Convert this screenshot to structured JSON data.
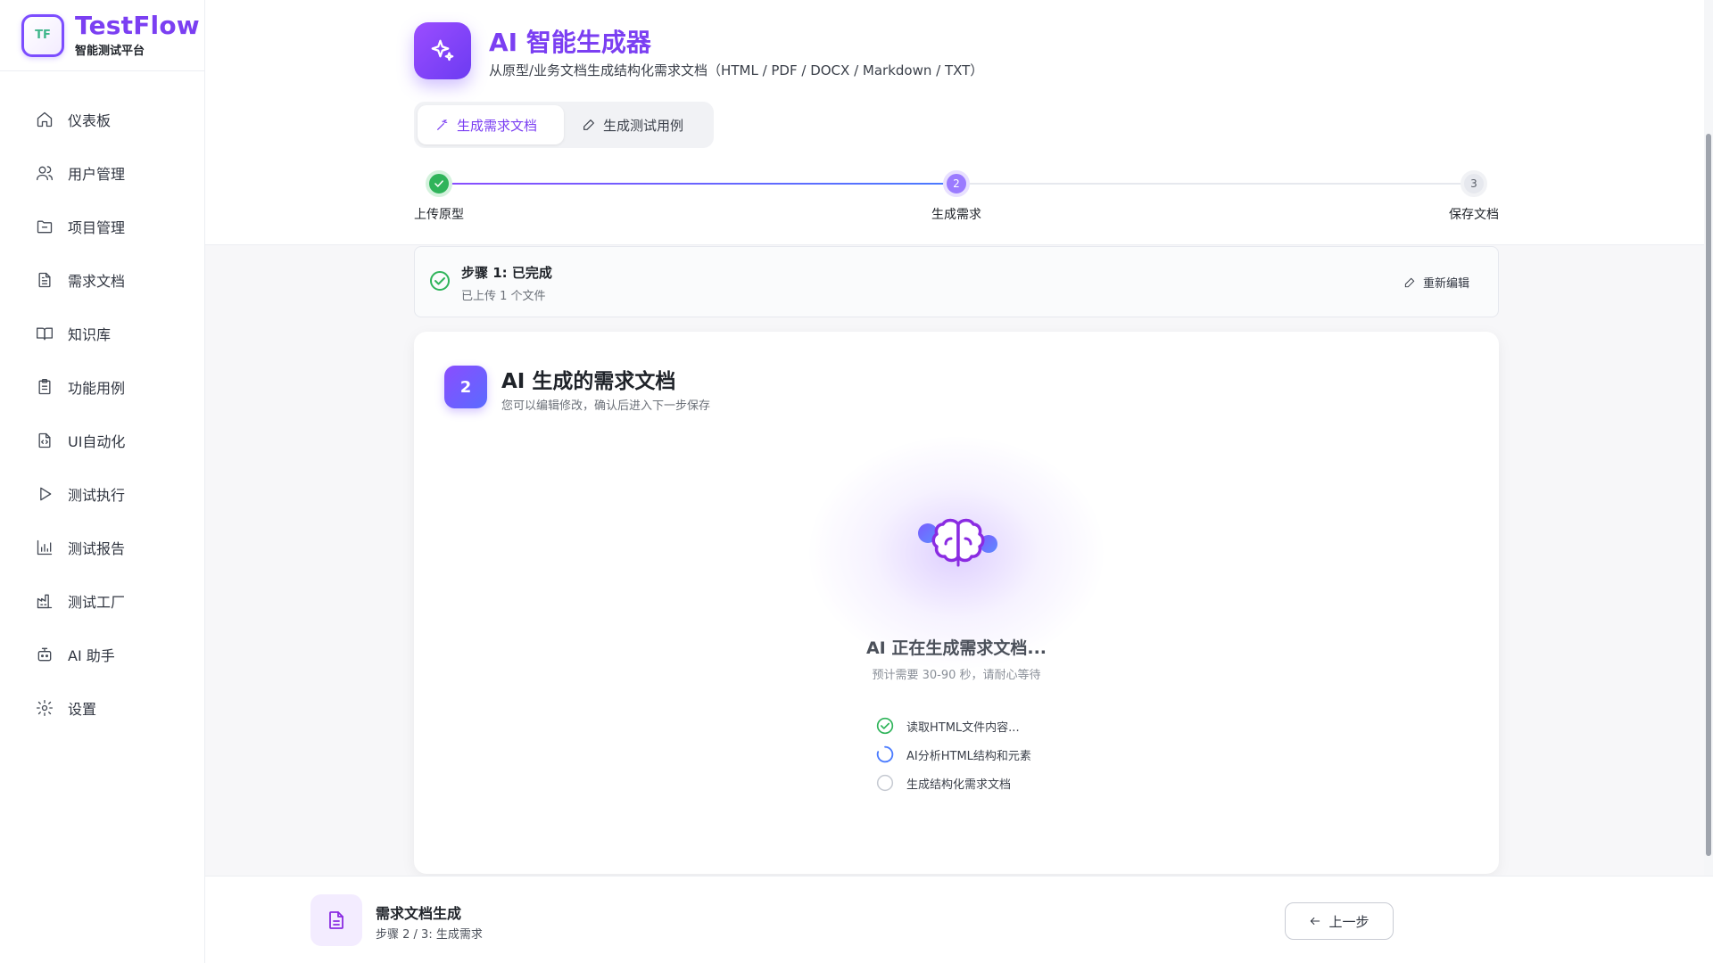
{
  "brand": {
    "title": "TestFlow",
    "subtitle": "智能测试平台",
    "logo_text": "TF"
  },
  "sidebar": {
    "items": [
      {
        "label": "仪表板",
        "icon": "home-icon"
      },
      {
        "label": "用户管理",
        "icon": "users-icon"
      },
      {
        "label": "项目管理",
        "icon": "folder-icon"
      },
      {
        "label": "需求文档",
        "icon": "file-text-icon"
      },
      {
        "label": "知识库",
        "icon": "book-icon"
      },
      {
        "label": "功能用例",
        "icon": "clipboard-icon"
      },
      {
        "label": "UI自动化",
        "icon": "file-code-icon"
      },
      {
        "label": "测试执行",
        "icon": "play-icon"
      },
      {
        "label": "测试报告",
        "icon": "bar-chart-icon"
      },
      {
        "label": "测试工厂",
        "icon": "factory-icon"
      },
      {
        "label": "AI 助手",
        "icon": "bot-icon"
      },
      {
        "label": "设置",
        "icon": "gear-icon"
      }
    ]
  },
  "header": {
    "title": "AI 智能生成器",
    "subtitle": "从原型/业务文档生成结构化需求文档（HTML / PDF / DOCX / Markdown / TXT）",
    "icon": "sparkles-icon"
  },
  "tabs": [
    {
      "label": "生成需求文档",
      "active": true
    },
    {
      "label": "生成测试用例",
      "active": false
    }
  ],
  "stepper": {
    "steps": [
      {
        "label": "上传原型",
        "status": "done"
      },
      {
        "label": "生成需求",
        "status": "active",
        "number": "2"
      },
      {
        "label": "保存文档",
        "status": "todo",
        "number": "3"
      }
    ]
  },
  "completed_step": {
    "title": "步骤 1: 已完成",
    "subtitle": "已上传 1 个文件",
    "action": "重新编辑"
  },
  "main_card": {
    "badge": "2",
    "title": "AI 生成的需求文档",
    "subtitle": "您可以编辑修改，确认后进入下一步保存",
    "generating_title": "AI 正在生成需求文档...",
    "generating_sub": "预计需要 30-90 秒，请耐心等待",
    "progress": [
      {
        "label": "读取HTML文件内容...",
        "status": "done"
      },
      {
        "label": "AI分析HTML结构和元素",
        "status": "loading"
      },
      {
        "label": "生成结构化需求文档",
        "status": "pending"
      }
    ]
  },
  "bottom_bar": {
    "title": "需求文档生成",
    "subtitle": "步骤 2 / 3:  生成需求",
    "prev_label": "上一步"
  },
  "colors": {
    "accent": "#7b3ff2",
    "success": "#2fb45a",
    "info": "#4a7bff"
  }
}
